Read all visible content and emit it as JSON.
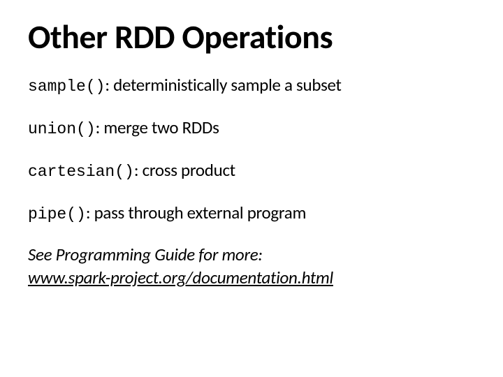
{
  "title": "Other RDD Operations",
  "operations": [
    {
      "name": "sample()",
      "desc": ": deterministically sample a subset"
    },
    {
      "name": "union()",
      "desc": ": merge two RDDs"
    },
    {
      "name": "cartesian()",
      "desc": ": cross product"
    },
    {
      "name": "pipe()",
      "desc": ": pass through external program"
    }
  ],
  "footer": {
    "lead": "See Programming Guide for more:",
    "link_text": "www.spark-project.org/documentation.html",
    "link_href": "http://www.spark-project.org/documentation.html"
  }
}
